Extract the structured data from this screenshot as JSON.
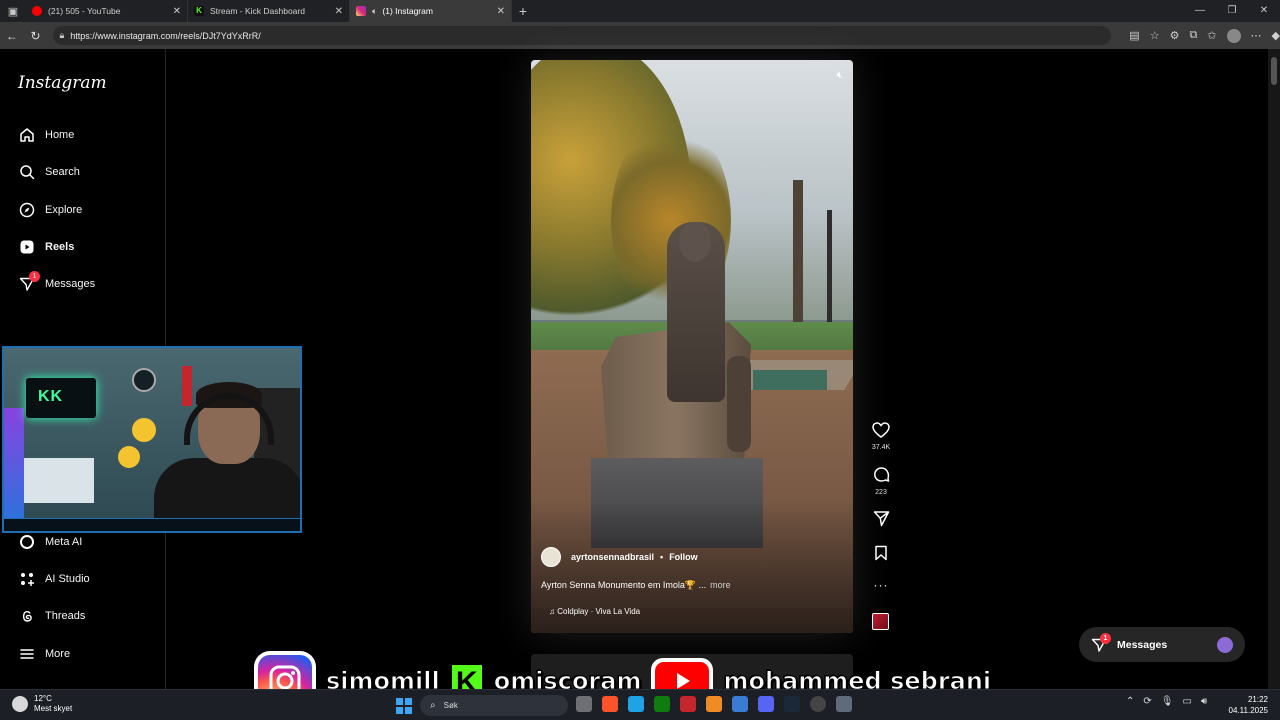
{
  "browser": {
    "tabs": [
      {
        "title": "(21) 505 - YouTube",
        "favicon": "youtube-icon",
        "active": false
      },
      {
        "title": "Stream - Kick Dashboard",
        "favicon": "kick-icon",
        "active": false
      },
      {
        "title": "(1) Instagram",
        "favicon": "instagram-icon",
        "active": true,
        "audio": true
      }
    ],
    "url": "https://www.instagram.com/reels/DJt7YdYxRrR/"
  },
  "sidebar": {
    "logo": "Instagram",
    "items": [
      {
        "label": "Home",
        "icon": "home-icon"
      },
      {
        "label": "Search",
        "icon": "search-icon"
      },
      {
        "label": "Explore",
        "icon": "compass-icon"
      },
      {
        "label": "Reels",
        "icon": "reels-icon",
        "active": true
      },
      {
        "label": "Messages",
        "icon": "messenger-icon",
        "badge": "1"
      },
      {
        "label": "Meta AI",
        "icon": "meta-ai-icon"
      },
      {
        "label": "AI Studio",
        "icon": "ai-studio-icon"
      },
      {
        "label": "Threads",
        "icon": "threads-icon"
      },
      {
        "label": "More",
        "icon": "menu-icon"
      }
    ]
  },
  "webcam": {
    "tv_text": "KK"
  },
  "reel": {
    "username": "ayrtonsennadbrasil",
    "follow": "Follow",
    "separator": "•",
    "caption": "Ayrton Senna Monumento em Imola🏆 ...",
    "more": "more",
    "music": "Coldplay · Viva La Vida",
    "likes": "37.4K",
    "comments": "223"
  },
  "messages_float": {
    "label": "Messages",
    "badge": "1"
  },
  "stream_overlay": {
    "instagram_name": "simomill",
    "kick_name": "omiscoram",
    "kick_letter": "K",
    "youtube_name": "mohammed sebrani"
  },
  "taskbar": {
    "weather_temp": "12°C",
    "weather_desc": "Mest skyet",
    "search_placeholder": "Søk",
    "time": "21:22",
    "date": "04.11.2025"
  },
  "colors": {
    "instagram_badge": "#ff3040",
    "kick_green": "#53fc18",
    "youtube_red": "#ff0000",
    "windows_blue": "#3ba7f5"
  }
}
